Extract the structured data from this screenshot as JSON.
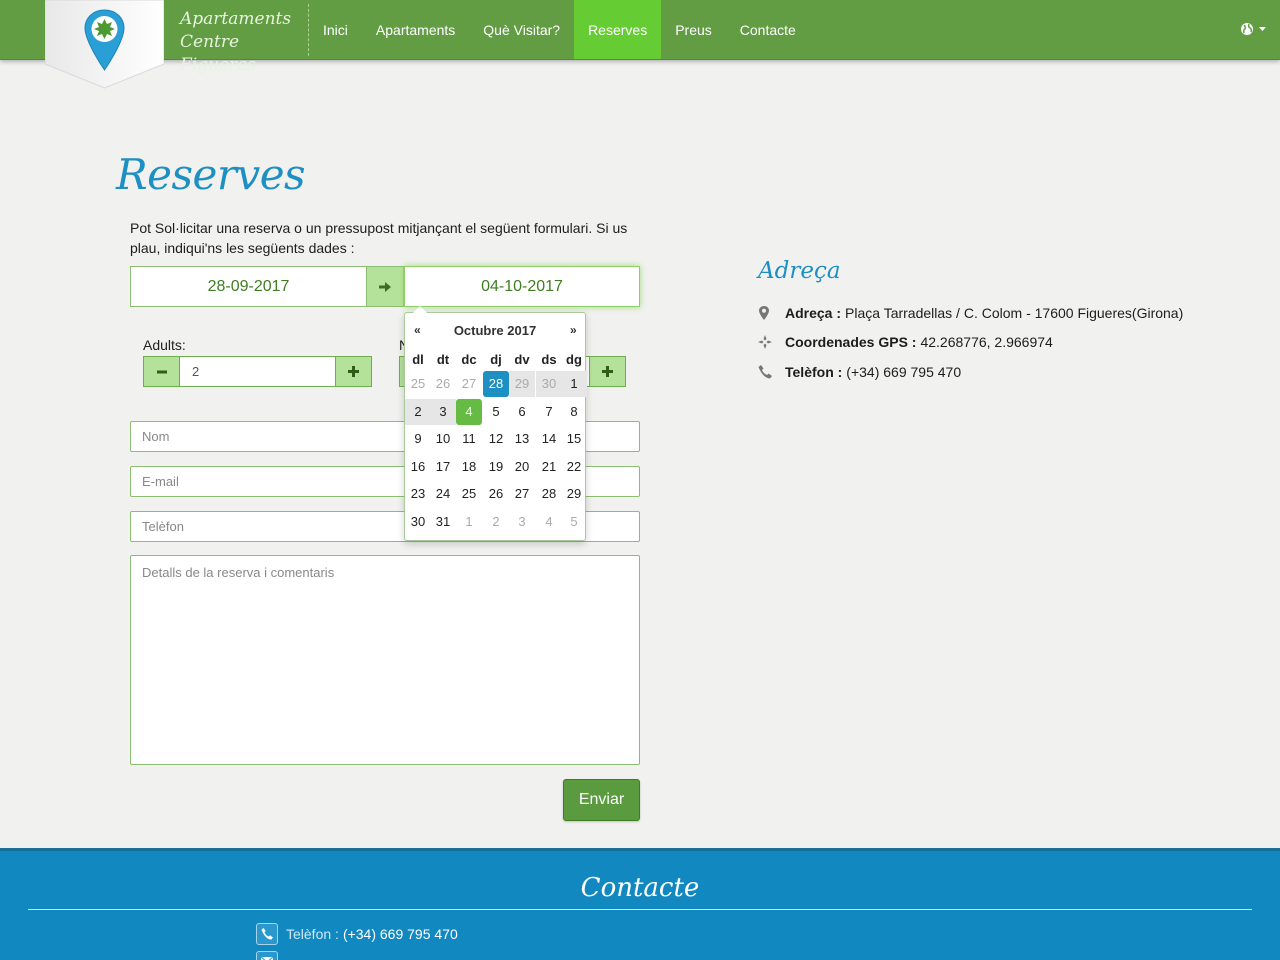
{
  "nav": {
    "brand_line1": "Apartaments",
    "brand_line2": "Centre Figueres",
    "items": [
      {
        "label": "Inici",
        "active": false
      },
      {
        "label": "Apartaments",
        "active": false
      },
      {
        "label": "Què Visitar?",
        "active": false
      },
      {
        "label": "Reserves",
        "active": true
      },
      {
        "label": "Preus",
        "active": false
      },
      {
        "label": "Contacte",
        "active": false
      }
    ],
    "language_icon": "globe-icon"
  },
  "page": {
    "title": "Reserves",
    "intro": "Pot Sol·licitar una reserva o un pressupost mitjançant el següent formulari. Si us plau, indiqui'ns les següents dades :"
  },
  "form": {
    "date_from": "28-09-2017",
    "date_to": "04-10-2017",
    "adults_label": "Adults:",
    "adults_value": "2",
    "name_placeholder": "Nom",
    "email_placeholder": "E-mail",
    "phone_placeholder": "Telèfon",
    "details_placeholder": "Detalls de la reserva i comentaris",
    "submit_label": "Enviar"
  },
  "datepicker": {
    "prev": "«",
    "next": "»",
    "month_title": "Octubre 2017",
    "weekdays": [
      "dl",
      "dt",
      "dc",
      "dj",
      "dv",
      "ds",
      "dg"
    ],
    "weeks": [
      [
        "25",
        "26",
        "27",
        "28",
        "29",
        "30",
        "1"
      ],
      [
        "2",
        "3",
        "4",
        "5",
        "6",
        "7",
        "8"
      ],
      [
        "9",
        "10",
        "11",
        "12",
        "13",
        "14",
        "15"
      ],
      [
        "16",
        "17",
        "18",
        "19",
        "20",
        "21",
        "22"
      ],
      [
        "23",
        "24",
        "25",
        "26",
        "27",
        "28",
        "29"
      ],
      [
        "30",
        "31",
        "1",
        "2",
        "3",
        "4",
        "5"
      ]
    ],
    "selected_start": "28",
    "selected_end": "4"
  },
  "address": {
    "title": "Adreça",
    "rows": [
      {
        "icon": "map-marker-icon",
        "label": "Adreça :",
        "value": "Plaça Tarradellas / C. Colom - 17600 Figueres(Girona)"
      },
      {
        "icon": "crosshair-icon",
        "label": "Coordenades GPS :",
        "value": "42.268776, 2.966974"
      },
      {
        "icon": "phone-icon",
        "label": "Telèfon :",
        "value": "(+34) 669 795 470"
      }
    ]
  },
  "footer": {
    "title": "Contacte",
    "phone_label": "Telèfon :",
    "phone_value": "(+34) 669 795 470"
  },
  "colors": {
    "nav_green": "#629d43",
    "active_green": "#66cc33",
    "title_blue": "#1e8fc2",
    "footer_blue": "#1188c0"
  }
}
